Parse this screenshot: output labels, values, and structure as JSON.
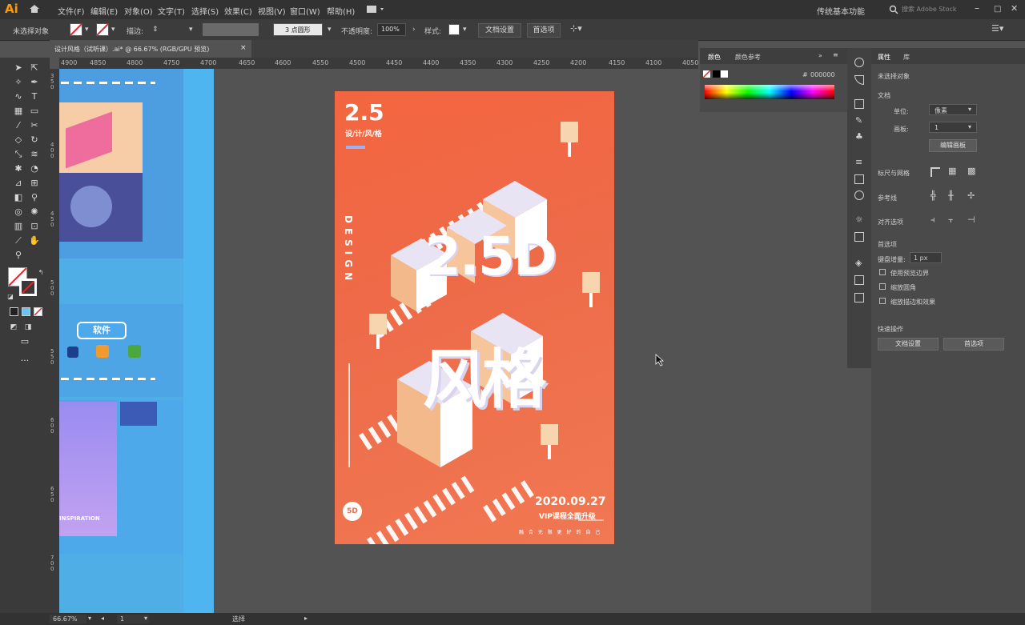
{
  "app": {
    "logo": "Ai",
    "workspace": "传统基本功能",
    "search_placeholder": "搜索 Adobe Stock"
  },
  "menu": [
    "文件(F)",
    "编辑(E)",
    "对象(O)",
    "文字(T)",
    "选择(S)",
    "效果(C)",
    "视图(V)",
    "窗口(W)",
    "帮助(H)"
  ],
  "control_bar": {
    "selection": "未选择对象",
    "stroke_label": "描边:",
    "brush_value": "3 点圆形",
    "opacity_label": "不透明度:",
    "opacity_value": "100%",
    "style_label": "样式:",
    "doc_setup": "文档设置",
    "preferences": "首选项"
  },
  "document_tab": {
    "title": "设计风格（试听课）.ai* @ 66.67% (RGB/GPU 预览)",
    "close": "×"
  },
  "ruler_ticks": [
    "4900",
    "4850",
    "4800",
    "4750",
    "4700",
    "4650",
    "4600",
    "4550",
    "4500",
    "4450",
    "4400",
    "4350",
    "4300",
    "4250",
    "4200",
    "4150",
    "4100",
    "4050"
  ],
  "ruler_left": [
    "350",
    "400",
    "450",
    "500",
    "550",
    "600",
    "650",
    "700"
  ],
  "color_panel": {
    "tab_color": "颜色",
    "tab_guide": "颜色参考",
    "hex_prefix": "#",
    "hex_value": "000000"
  },
  "properties_panel": {
    "tab_props": "属性",
    "tab_other": "库",
    "no_selection": "未选择对象",
    "document_section": "文档",
    "units_label": "单位:",
    "units_value": "像素",
    "artboard_label": "画板:",
    "artboard_value": "1",
    "edit_artboard": "编辑画板",
    "rulers_grids": "标尺与网格",
    "guides": "参考线",
    "align_to": "对齐选项",
    "preferences_section": "首选项",
    "keyboard_increment_label": "键盘增量:",
    "keyboard_increment_value": "1 px",
    "use_preview_bounds": "使用预览边界",
    "scale_corners": "缩放圆角",
    "scale_strokes": "缩放描边和效果",
    "quick_actions": "快速操作",
    "doc_setup_btn": "文档设置",
    "prefs_btn": "首选项"
  },
  "poster": {
    "number": "2.5",
    "subtitle": "设/计/风/格",
    "design_vertical": "DESIGN",
    "badge": "5D",
    "date": "2020.09.27",
    "vip": "VIP课程全面升级",
    "tagline": "融 合 无 限 更 好 的 自 己",
    "big_text": "2.5D",
    "big_chars": "风格"
  },
  "left_artboards": {
    "button_label": "软件",
    "inspiration": "INSPIRATION"
  },
  "status_bar": {
    "zoom": "66.67%",
    "artboard": "1",
    "tool": "选择"
  },
  "colors": {
    "accent": "#f06b47",
    "ui_dark": "#323232",
    "ui_panel": "#4a4a4a",
    "canvas": "#535353",
    "artboard_blue": "#52b4ec"
  }
}
